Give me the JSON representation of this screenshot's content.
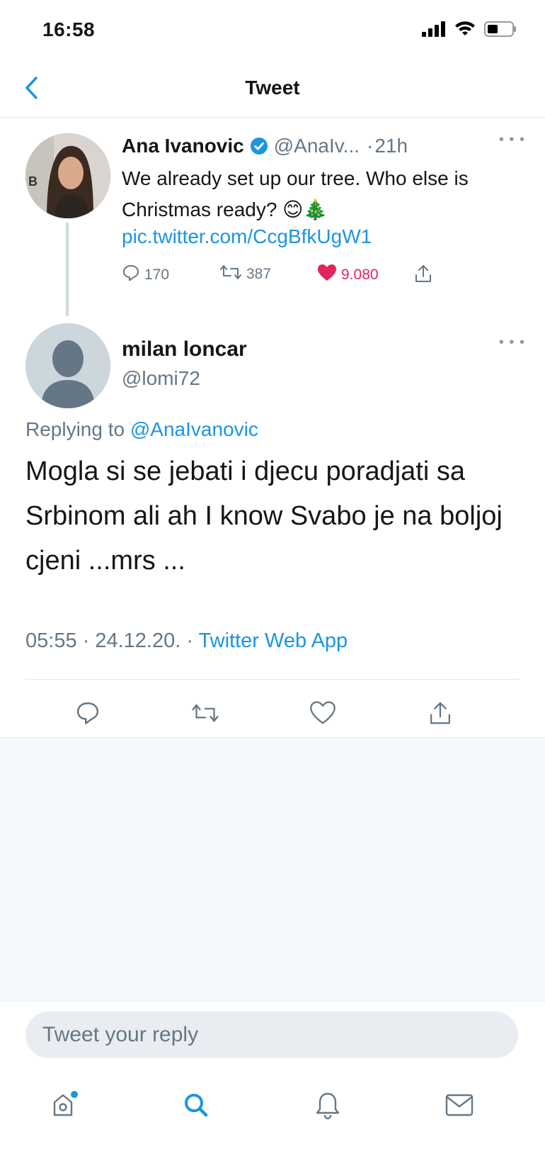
{
  "status_bar": {
    "time": "16:58"
  },
  "nav": {
    "title": "Tweet",
    "back_icon": "chevron-left-icon"
  },
  "original_tweet": {
    "author_name": "Ana Ivanovic",
    "verified": true,
    "handle": "@AnaIv...",
    "separator": "·",
    "time": "21h",
    "text": "We already set up our tree. Who else is Christmas ready? 😊🎄",
    "link": "pic.twitter.com/CcgBfkUgW1",
    "actions": {
      "replies": "170",
      "retweets": "387",
      "likes": "9.080"
    },
    "avatar_letter": "B"
  },
  "reply_tweet": {
    "author_name": "milan loncar",
    "handle": "@lomi72",
    "replying_prefix": "Replying to ",
    "replying_to": "@AnaIvanovic",
    "text": "Mogla si se jebati i djecu poradjati sa Srbinom ali ah I know Svabo je na boljoj cjeni ...mrs ...",
    "timestamp": "05:55 · 24.12.20. · ",
    "source": "Twitter Web App"
  },
  "compose": {
    "placeholder": "Tweet your reply"
  },
  "tab_bar": {
    "items": [
      "home-icon",
      "search-icon",
      "notifications-icon",
      "messages-icon"
    ],
    "active": "search-icon",
    "accent_color": "#1b95e0"
  },
  "colors": {
    "accent": "#1b95e0",
    "like": "#e0245e",
    "secondary_text": "#657786"
  }
}
